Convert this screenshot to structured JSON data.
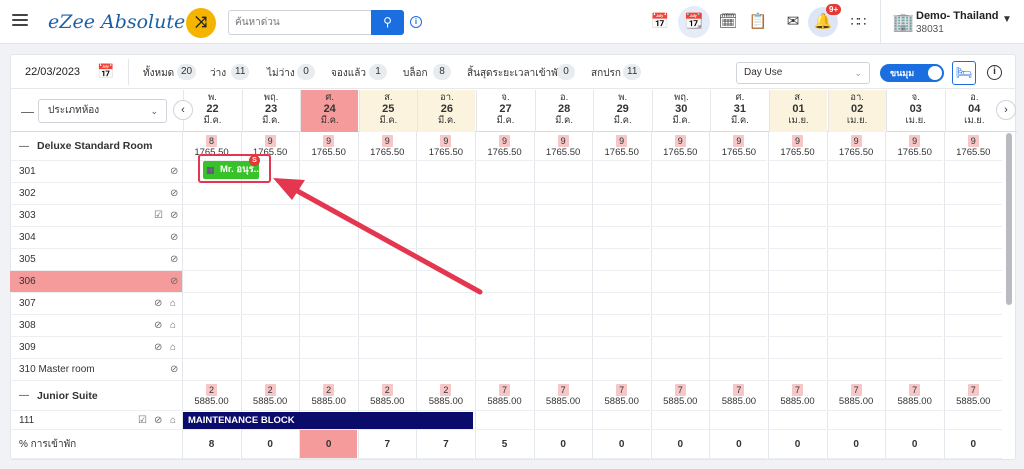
{
  "app": {
    "logo_text": "eZee Absolute"
  },
  "search": {
    "placeholder": "ค้นหาด่วน"
  },
  "hotel": {
    "name": "Demo- Thailand",
    "code": "38031"
  },
  "notifications": {
    "badge": "9+"
  },
  "filters": {
    "date": "22/03/2023",
    "stats": [
      {
        "label": "ทั้งหมด",
        "count": "20"
      },
      {
        "label": "ว่าง",
        "count": "11"
      },
      {
        "label": "ไม่ว่าง",
        "count": "0"
      },
      {
        "label": "จองแล้ว",
        "count": "1"
      },
      {
        "label": "บล็อก",
        "count": "8"
      },
      {
        "label": "สิ้นสุดระยะเวลาเข้าพัก",
        "count": "0"
      },
      {
        "label": "สกปรก",
        "count": "11"
      }
    ],
    "day_use": "Day Use",
    "toggle_label": "ขนมุม"
  },
  "grid": {
    "room_type_select": "ประเภทห้อง",
    "days": [
      {
        "dow": "พ.",
        "day": "22",
        "month": "มี.ค.",
        "kind": "normal"
      },
      {
        "dow": "พฤ.",
        "day": "23",
        "month": "มี.ค.",
        "kind": "normal"
      },
      {
        "dow": "ศ.",
        "day": "24",
        "month": "มี.ค.",
        "kind": "today"
      },
      {
        "dow": "ส.",
        "day": "25",
        "month": "มี.ค.",
        "kind": "weekend"
      },
      {
        "dow": "อา.",
        "day": "26",
        "month": "มี.ค.",
        "kind": "weekend"
      },
      {
        "dow": "จ.",
        "day": "27",
        "month": "มี.ค.",
        "kind": "normal"
      },
      {
        "dow": "อ.",
        "day": "28",
        "month": "มี.ค.",
        "kind": "normal"
      },
      {
        "dow": "พ.",
        "day": "29",
        "month": "มี.ค.",
        "kind": "normal"
      },
      {
        "dow": "พฤ.",
        "day": "30",
        "month": "มี.ค.",
        "kind": "normal"
      },
      {
        "dow": "ศ.",
        "day": "31",
        "month": "มี.ค.",
        "kind": "normal"
      },
      {
        "dow": "ส.",
        "day": "01",
        "month": "เม.ย.",
        "kind": "weekend"
      },
      {
        "dow": "อา.",
        "day": "02",
        "month": "เม.ย.",
        "kind": "weekend"
      },
      {
        "dow": "จ.",
        "day": "03",
        "month": "เม.ย.",
        "kind": "normal"
      },
      {
        "dow": "อ.",
        "day": "04",
        "month": "เม.ย.",
        "kind": "normal"
      }
    ],
    "categories": [
      {
        "name": "Deluxe Standard Room",
        "avail": [
          "8",
          "9",
          "9",
          "9",
          "9",
          "9",
          "9",
          "9",
          "9",
          "9",
          "9",
          "9",
          "9",
          "9"
        ],
        "rate": "1765.50"
      },
      {
        "name": "Junior Suite",
        "avail": [
          "2",
          "2",
          "2",
          "2",
          "2",
          "7",
          "7",
          "7",
          "7",
          "7",
          "7",
          "7",
          "7",
          "7"
        ],
        "rate": "5885.00"
      }
    ],
    "rooms": [
      {
        "name": "301",
        "icons": [
          "broom"
        ]
      },
      {
        "name": "302",
        "icons": [
          "broom"
        ]
      },
      {
        "name": "303",
        "icons": [
          "check",
          "broom"
        ]
      },
      {
        "name": "304",
        "icons": [
          "broom"
        ]
      },
      {
        "name": "305",
        "icons": [
          "broom"
        ]
      },
      {
        "name": "306",
        "icons": [
          "broom"
        ]
      },
      {
        "name": "307",
        "icons": [
          "broom",
          "clean"
        ]
      },
      {
        "name": "308",
        "icons": [
          "broom",
          "clean"
        ]
      },
      {
        "name": "309",
        "icons": [
          "broom",
          "clean"
        ]
      },
      {
        "name": "310 Master room",
        "icons": [
          "broom"
        ]
      },
      {
        "name": "111",
        "icons": [
          "check",
          "broom",
          "clean"
        ]
      }
    ],
    "booking": {
      "label": "Mr. อนุร...",
      "badge": "S"
    },
    "maintenance": {
      "label": "MAINTENANCE BLOCK"
    },
    "occupancy": {
      "label": "% การเข้าพัก",
      "values": [
        "8",
        "0",
        "0",
        "7",
        "7",
        "5",
        "0",
        "0",
        "0",
        "0",
        "0",
        "0",
        "0",
        "0"
      ]
    }
  },
  "colors": {
    "today": "#f69b9b",
    "weekend": "#fbf3dd",
    "booking": "#37c22a",
    "maintenance": "#0b0b6b",
    "accent": "#1b6ee0",
    "arrow": "#e5364f"
  }
}
